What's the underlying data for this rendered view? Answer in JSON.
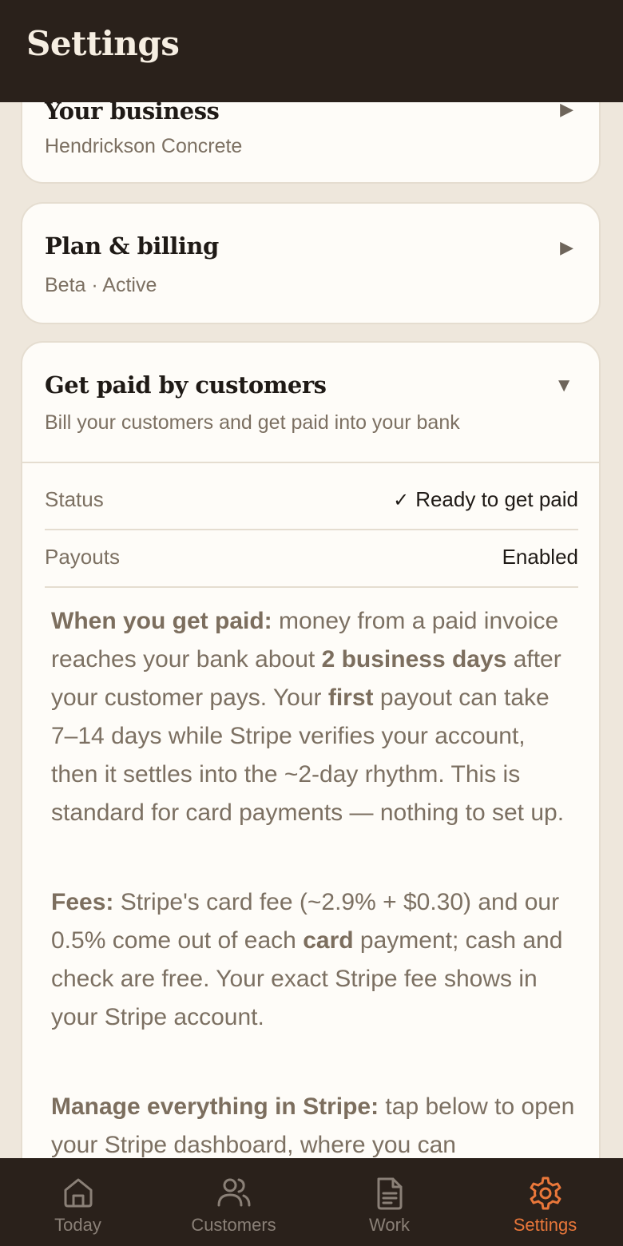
{
  "header": {
    "title": "Settings"
  },
  "cards": {
    "business": {
      "title": "Your business",
      "subtitle": "Hendrickson Concrete",
      "arrow": "▶"
    },
    "plan": {
      "title": "Plan & billing",
      "subtitle": "Beta · Active",
      "arrow": "▶"
    },
    "payments": {
      "title": "Get paid by customers",
      "subtitle": "Bill your customers and get paid into your bank",
      "arrow": "▼",
      "rows": [
        {
          "label": "Status",
          "check": "✓",
          "value": "Ready to get paid"
        },
        {
          "label": "Payouts",
          "value": "Enabled"
        }
      ],
      "paragraphs": {
        "when": {
          "bold1": "When you get paid:",
          "t1": " money from a paid invoice reaches your bank about ",
          "bold2": "2 business days",
          "t2": " after your customer pays. Your ",
          "bold3": "first",
          "t3": " payout can take 7–14 days while Stripe verifies your account, then it settles into the ~2-day rhythm. This is standard for card payments — nothing to set up."
        },
        "fees": {
          "bold1": "Fees:",
          "t1": " Stripe's card fee (~2.9% + $0.30) and our 0.5% come out of each ",
          "bold2": "card",
          "t2": " payment; cash and check are free. Your exact Stripe fee shows in your Stripe account."
        },
        "manage": {
          "bold1": "Manage everything in Stripe:",
          "t1": " tap below to open your Stripe dashboard, where you can"
        }
      }
    }
  },
  "tabs": [
    {
      "label": "Today",
      "icon": "home-icon"
    },
    {
      "label": "Customers",
      "icon": "users-icon"
    },
    {
      "label": "Work",
      "icon": "document-icon"
    },
    {
      "label": "Settings",
      "icon": "gear-icon"
    }
  ],
  "colors": {
    "active": "#E9773A",
    "inactive": "#8A8077",
    "bar": "#2A211B",
    "background": "#EEE7DC"
  }
}
